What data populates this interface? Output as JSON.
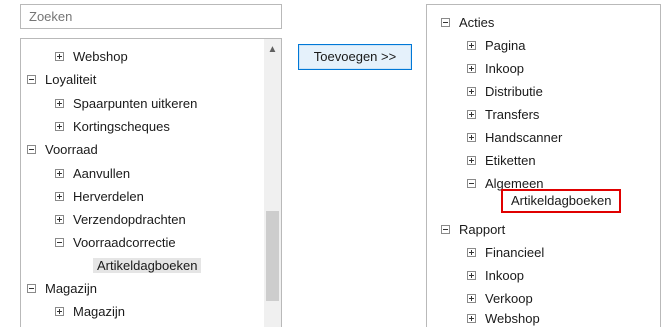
{
  "search": {
    "placeholder": "Zoeken"
  },
  "add_button": {
    "label": "Toevoegen >>"
  },
  "left_tree": {
    "scroll_up_glyph": "▲",
    "nodes": [
      {
        "label": "Webshop"
      },
      {
        "label": "Loyaliteit"
      },
      {
        "label": "Spaarpunten uitkeren"
      },
      {
        "label": "Kortingscheques"
      },
      {
        "label": "Voorraad"
      },
      {
        "label": "Aanvullen"
      },
      {
        "label": "Herverdelen"
      },
      {
        "label": "Verzendopdrachten"
      },
      {
        "label": "Voorraadcorrectie"
      },
      {
        "label": "Artikeldagboeken"
      },
      {
        "label": "Magazijn"
      },
      {
        "label": "Magazijn"
      }
    ]
  },
  "right_tree": {
    "nodes": [
      {
        "label": "Acties"
      },
      {
        "label": "Pagina"
      },
      {
        "label": "Inkoop"
      },
      {
        "label": "Distributie"
      },
      {
        "label": "Transfers"
      },
      {
        "label": "Handscanner"
      },
      {
        "label": "Etiketten"
      },
      {
        "label": "Algemeen"
      },
      {
        "label": "Artikeldagboeken"
      },
      {
        "label": "Rapport"
      },
      {
        "label": "Financieel"
      },
      {
        "label": "Inkoop"
      },
      {
        "label": "Verkoop"
      },
      {
        "label": "Webshop"
      }
    ]
  },
  "colors": {
    "highlight_border": "#e00000",
    "button_border": "#0078d7"
  }
}
